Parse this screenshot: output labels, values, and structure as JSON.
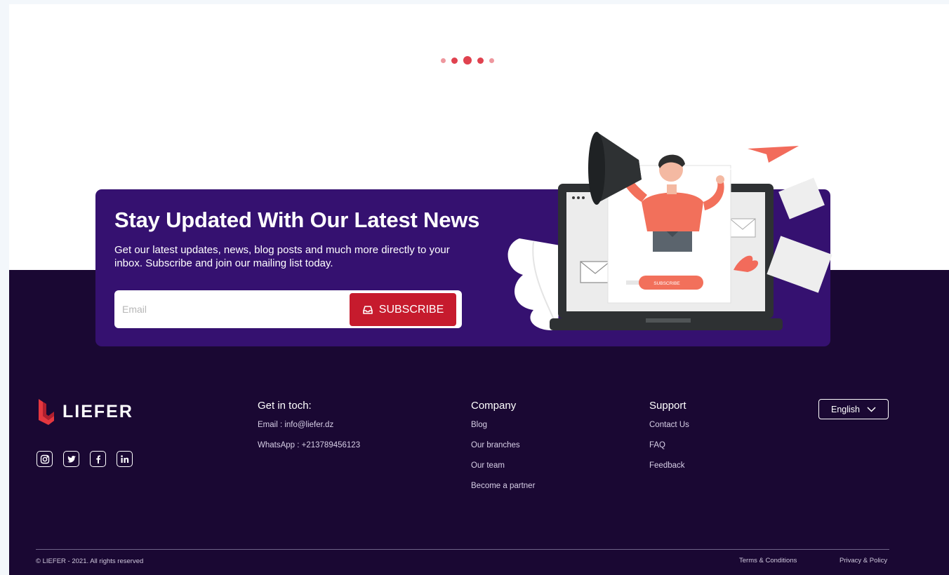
{
  "carousel": {
    "dot_count": 5,
    "active_index": 2
  },
  "newsletter": {
    "title": "Stay Updated With Our Latest News",
    "description": "Get our latest updates, news, blog posts and much more directly to your inbox. Subscribe and join our mailing list today.",
    "email_placeholder": "Email",
    "subscribe_label": "SUBSCRIBE",
    "illustration_button_label": "SUBSCRIBE"
  },
  "footer": {
    "brand": "LIEFER",
    "socials": [
      "instagram-icon",
      "twitter-icon",
      "facebook-icon",
      "linkedin-icon"
    ],
    "contact": {
      "title": "Get in toch:",
      "items": [
        "Email : info@liefer.dz",
        "WhatsApp : +213789456123"
      ]
    },
    "company": {
      "title": "Company",
      "items": [
        "Blog",
        "Our branches",
        "Our team",
        "Become a partner"
      ]
    },
    "support": {
      "title": "Support",
      "items": [
        "Contact Us",
        "FAQ",
        "Feedback"
      ]
    },
    "language": "English",
    "copyright": "© LIEFER - 2021. All rights reserved",
    "terms": "Terms & Conditions",
    "privacy": "Privacy & Policy"
  },
  "colors": {
    "accent": "#c61b2d",
    "card": "#351170",
    "footer_bg": "#1a0833"
  }
}
